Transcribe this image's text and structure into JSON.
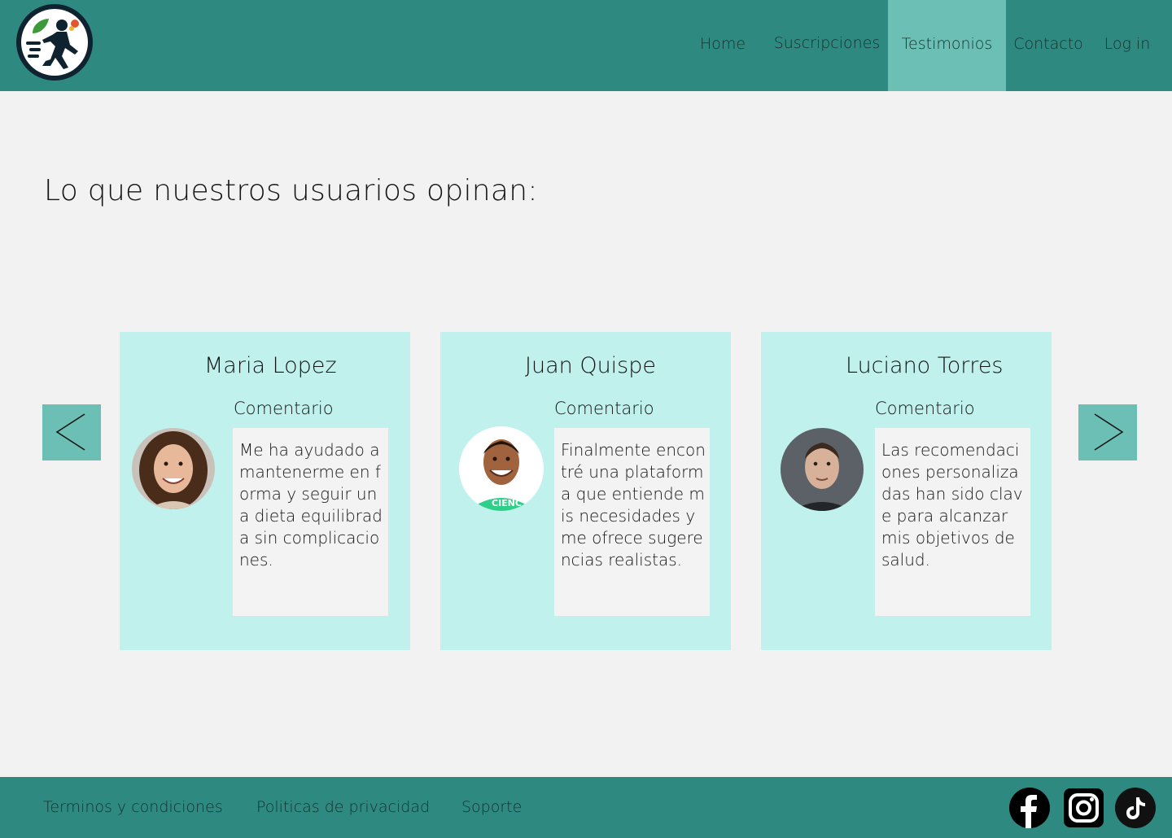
{
  "header": {
    "logo_name": "runner-logo",
    "nav": [
      {
        "label": "Home",
        "active": false
      },
      {
        "label": "Suscripciones",
        "active": false
      },
      {
        "label": "Testimonios",
        "active": true
      },
      {
        "label": "Contacto",
        "active": false
      },
      {
        "label": "Log in",
        "active": false
      }
    ]
  },
  "main": {
    "title": "Lo que nuestros usuarios opinan:",
    "carousel": {
      "prev_icon": "chevron-left-icon",
      "next_icon": "chevron-right-icon",
      "cards": [
        {
          "name": "Maria Lopez",
          "label": "Comentario",
          "comment": "Me ha ayudado a mantenerme en forma y seguir una dieta equilibrada sin complicaciones."
        },
        {
          "name": "Juan Quispe",
          "label": "Comentario",
          "comment": "Finalmente encontré una plataforma que entiende mis necesidades y me ofrece sugerencias realistas."
        },
        {
          "name": "Luciano Torres",
          "label": "Comentario",
          "comment": "Las recomendaciones personalizadas han sido clave para alcanzar mis objetivos de salud."
        }
      ]
    }
  },
  "footer": {
    "links": [
      "Terminos y condiciones",
      "Politicas de privacidad",
      "Soporte"
    ],
    "social": [
      "facebook-icon",
      "instagram-icon",
      "tiktok-icon"
    ]
  },
  "colors": {
    "header_bg": "#2e8a80",
    "nav_active_bg": "#6bbfb5",
    "card_bg": "#c1f1ec",
    "page_bg": "#f2f2f2"
  }
}
